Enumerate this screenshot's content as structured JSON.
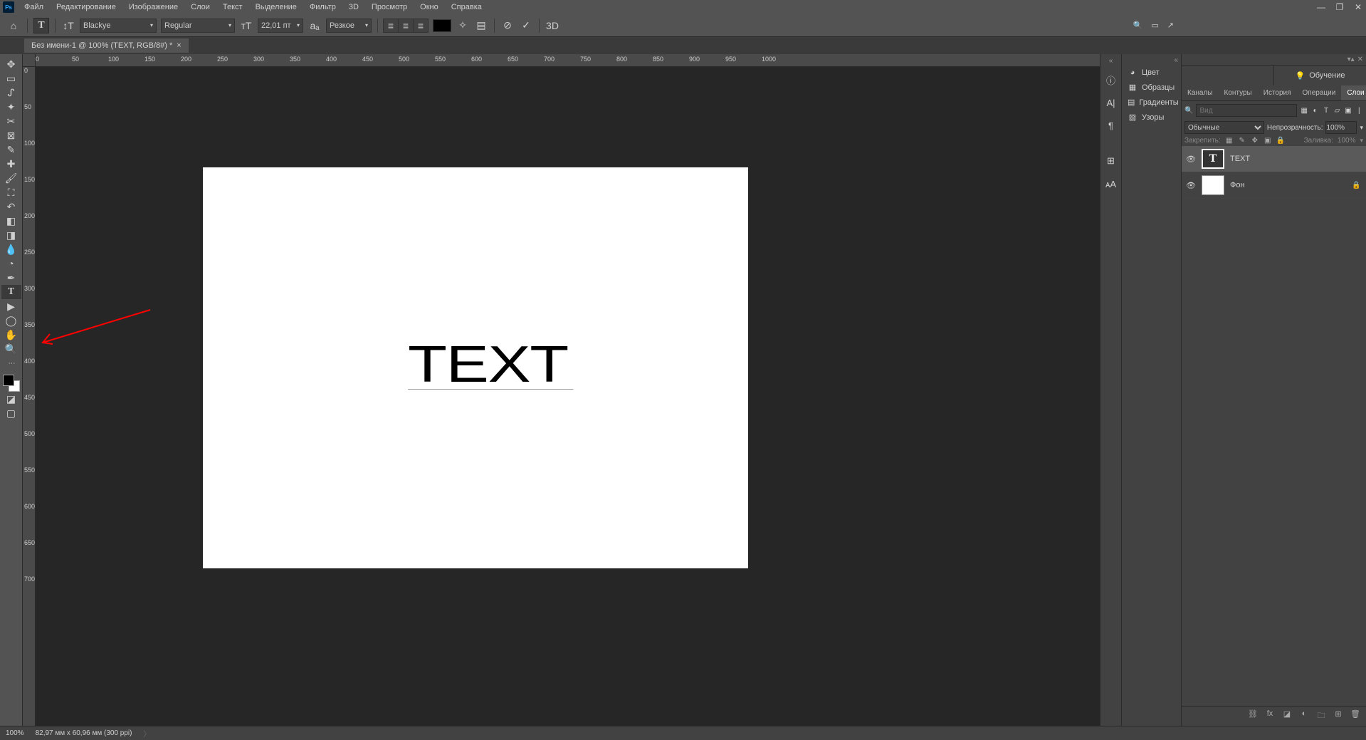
{
  "menubar": {
    "items": [
      "Файл",
      "Редактирование",
      "Изображение",
      "Слои",
      "Текст",
      "Выделение",
      "Фильтр",
      "3D",
      "Просмотр",
      "Окно",
      "Справка"
    ]
  },
  "options": {
    "font_family": "Blackye",
    "font_style": "Regular",
    "font_size": "22,01 пт",
    "aa_mode": "Резкое"
  },
  "doc_tab": {
    "title": "Без имени-1 @ 100% (TEXT, RGB/8#) *"
  },
  "canvas": {
    "text": "TEXT"
  },
  "ruler_h": [
    "0",
    "50",
    "100",
    "150",
    "200",
    "250",
    "300",
    "350",
    "400",
    "450",
    "500",
    "550",
    "600",
    "650",
    "700",
    "750",
    "800",
    "850",
    "900",
    "950",
    "1000"
  ],
  "ruler_v": [
    "0",
    "50",
    "100",
    "150",
    "200",
    "250",
    "300",
    "350",
    "400",
    "450",
    "500",
    "550",
    "600",
    "650",
    "700"
  ],
  "popup_panels": {
    "items": [
      {
        "icon": "◕",
        "label": "Цвет"
      },
      {
        "icon": "▦",
        "label": "Образцы"
      },
      {
        "icon": "▤",
        "label": "Градиенты"
      },
      {
        "icon": "▨",
        "label": "Узоры"
      }
    ]
  },
  "learn_tab": "Обучение",
  "layers_tabs": [
    "Каналы",
    "Контуры",
    "История",
    "Операции",
    "Слои"
  ],
  "layers_search_placeholder": "Вид",
  "blend": {
    "mode": "Обычные",
    "opacity_label": "Непрозрачность:",
    "opacity": "100%"
  },
  "lock": {
    "label": "Закрепить:",
    "fill_label": "Заливка:",
    "fill": "100%"
  },
  "layers": [
    {
      "eye": true,
      "thumb_type": "text",
      "thumb_label": "T",
      "name": "TEXT",
      "selected": true,
      "locked": false
    },
    {
      "eye": true,
      "thumb_type": "img",
      "thumb_label": "",
      "name": "Фон",
      "selected": false,
      "locked": true
    }
  ],
  "status": {
    "zoom": "100%",
    "dim": "82,97 мм x 60,96 мм (300 ppi)"
  }
}
